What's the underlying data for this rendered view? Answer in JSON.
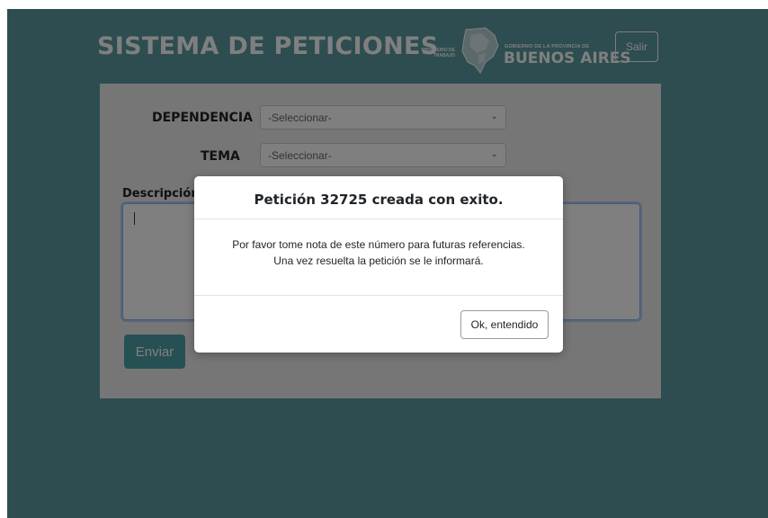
{
  "header": {
    "title": "SISTEMA DE PETICIONES",
    "ministerio_line1": "MINISTERIO DE",
    "ministerio_line2": "TRABAJO",
    "gobierno_small": "GOBIERNO DE LA PROVINCIA DE",
    "gobierno_big": "BUENOS AIRES",
    "logout_label": "Salir"
  },
  "form": {
    "dependencia_label": "DEPENDENCIA",
    "dependencia_value": "-Seleccionar-",
    "tema_label": "TEMA",
    "tema_value": "-Seleccionar-",
    "descripcion_label": "Descripción",
    "descripcion_value": "",
    "submit_label": "Enviar"
  },
  "modal": {
    "title": "Petición 32725 creada con exito.",
    "body_line1": "Por favor tome nota de este número para futuras referencias.",
    "body_line2": "Una vez resuelta la petición se le informará.",
    "ok_label": "Ok, entendido"
  },
  "colors": {
    "header_bg": "#5a9aa0",
    "button_accent": "#4fa1a8"
  }
}
